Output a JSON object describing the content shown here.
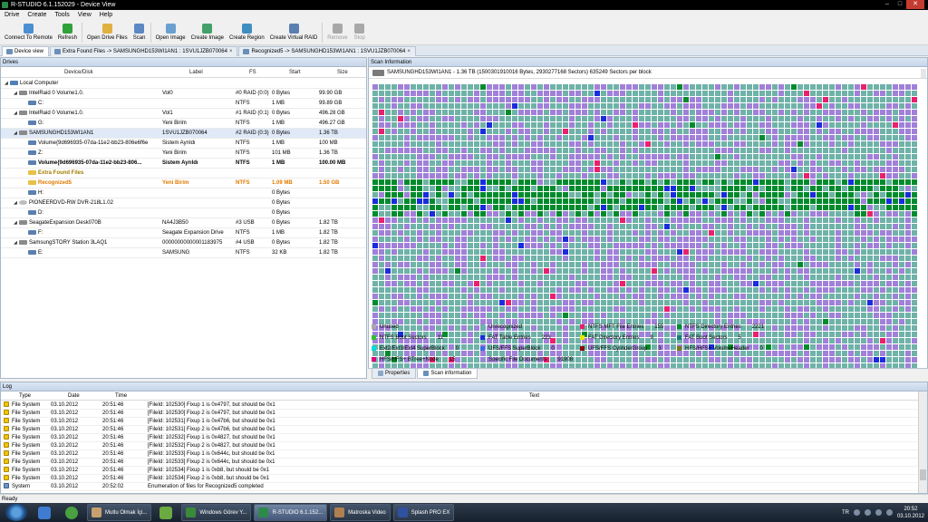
{
  "window": {
    "title": "R-STUDIO 6.1.152029 - Device View"
  },
  "menu": [
    "Drive",
    "Create",
    "Tools",
    "View",
    "Help"
  ],
  "toolbar": [
    {
      "label": "Connect To Remote",
      "icon": "connect-remote-icon",
      "color": "#4a8fd0",
      "enabled": true
    },
    {
      "label": "Refresh",
      "icon": "refresh-icon",
      "color": "#2fa23a",
      "enabled": true
    },
    {
      "label": "Open Drive Files",
      "icon": "open-drive-files-icon",
      "color": "#e0b040",
      "enabled": true
    },
    {
      "label": "Scan",
      "icon": "scan-icon",
      "color": "#5c88c4",
      "enabled": true
    },
    {
      "label": "Open Image",
      "icon": "open-image-icon",
      "color": "#6aa0d0",
      "enabled": true
    },
    {
      "label": "Create Image",
      "icon": "create-image-icon",
      "color": "#44a06a",
      "enabled": true
    },
    {
      "label": "Create Region",
      "icon": "create-region-icon",
      "color": "#3f8ec0",
      "enabled": true
    },
    {
      "label": "Create Virtual RAID",
      "icon": "create-virtual-raid-icon",
      "color": "#5a7fb0",
      "enabled": true
    },
    {
      "label": "Remove",
      "icon": "remove-icon",
      "color": "#a8a8a8",
      "enabled": false
    },
    {
      "label": "Stop",
      "icon": "stop-icon",
      "color": "#a8a8a8",
      "enabled": false
    }
  ],
  "tabs": [
    {
      "label": "Device view",
      "active": true,
      "closable": false
    },
    {
      "label": "Extra Found Files -> SAMSUNGHD153WI1AN1 : 1SVU1JZB070064",
      "active": false,
      "closable": true
    },
    {
      "label": "Recognized5 -> SAMSUNGHD153WI1AN1 : 1SVU1JZB070064",
      "active": false,
      "closable": true
    }
  ],
  "drives": {
    "title": "Drives",
    "columns": {
      "device": "Device/Disk",
      "label": "Label",
      "fs": "FS",
      "start": "Start",
      "size": "Size"
    },
    "rows": [
      {
        "indent": 0,
        "icon": "pc",
        "name": "Local Computer",
        "label": "",
        "fs": "",
        "start": "",
        "size": "",
        "style": ""
      },
      {
        "indent": 1,
        "icon": "hd",
        "name": "IntelRaid 0 Volume1.0.",
        "label": "Vol0",
        "fs": "#0 RAID (0:0)",
        "start": "0 Bytes",
        "size": "99.90 GB",
        "style": ""
      },
      {
        "indent": 2,
        "icon": "vol",
        "name": "C:",
        "label": "",
        "fs": "NTFS",
        "start": "1 MB",
        "size": "99.89 GB",
        "style": ""
      },
      {
        "indent": 1,
        "icon": "hd",
        "name": "IntelRaid 0 Volume1.0.",
        "label": "Vol1",
        "fs": "#1 RAID (0:1)",
        "start": "0 Bytes",
        "size": "496.28 GB",
        "style": ""
      },
      {
        "indent": 2,
        "icon": "vol",
        "name": "G:",
        "label": "Yeni Birim",
        "fs": "NTFS",
        "start": "1 MB",
        "size": "496.27 GB",
        "style": ""
      },
      {
        "indent": 1,
        "icon": "hd",
        "name": "SAMSUNGHD153WI1AN1",
        "label": "1SVU1JZB070064",
        "fs": "#2 RAID (0:3)",
        "start": "0 Bytes",
        "size": "1.36 TB",
        "style": "sel"
      },
      {
        "indent": 2,
        "icon": "vol",
        "name": "Volume{9d696935-07da-11e2-bb23-806e6f6e",
        "label": "Sistem Ayrıldı",
        "fs": "NTFS",
        "start": "1 MB",
        "size": "100 MB",
        "style": ""
      },
      {
        "indent": 2,
        "icon": "vol",
        "name": "Z:",
        "label": "Yeni Birim",
        "fs": "NTFS",
        "start": "101 MB",
        "size": "1.36 TB",
        "style": ""
      },
      {
        "indent": 2,
        "icon": "vol",
        "name": "Volume{9d696935-07da-11e2-bb23-806...",
        "label": "Sistem Ayrıldı",
        "fs": "NTFS",
        "start": "1 MB",
        "size": "100.00 MB",
        "style": "bold"
      },
      {
        "indent": 2,
        "icon": "fold",
        "name": "Extra Found Files",
        "label": "",
        "fs": "",
        "start": "",
        "size": "",
        "style": "olive"
      },
      {
        "indent": 2,
        "icon": "fold",
        "name": "Recognized5",
        "label": "Yeni Birim",
        "fs": "NTFS",
        "start": "1.09 MB",
        "size": "1.50 GB",
        "style": "orange"
      },
      {
        "indent": 2,
        "icon": "vol",
        "name": "H:",
        "label": "",
        "fs": "",
        "start": "0 Bytes",
        "size": "",
        "style": ""
      },
      {
        "indent": 1,
        "icon": "cd",
        "name": "PIONEERDVD-RW DVR-218L1.02",
        "label": "",
        "fs": "",
        "start": "0 Bytes",
        "size": "",
        "style": ""
      },
      {
        "indent": 2,
        "icon": "vol",
        "name": "D:",
        "label": "",
        "fs": "",
        "start": "0 Bytes",
        "size": "",
        "style": ""
      },
      {
        "indent": 1,
        "icon": "hd",
        "name": "SeagateExpansion Desk070B",
        "label": "NA4J3B50",
        "fs": "#3 USB",
        "start": "0 Bytes",
        "size": "1.82 TB",
        "style": ""
      },
      {
        "indent": 2,
        "icon": "vol",
        "name": "F:",
        "label": "Seagate Expansion Drive",
        "fs": "NTFS",
        "start": "1 MB",
        "size": "1.82 TB",
        "style": ""
      },
      {
        "indent": 1,
        "icon": "hd",
        "name": "SamsungSTORY Station 3LAQ1",
        "label": "00000000000001183975",
        "fs": "#4 USB",
        "start": "0 Bytes",
        "size": "1.82 TB",
        "style": ""
      },
      {
        "indent": 2,
        "icon": "vol",
        "name": "E:",
        "label": "SAMSUNG",
        "fs": "NTFS",
        "start": "32 KB",
        "size": "1.82 TB",
        "style": ""
      }
    ]
  },
  "scan": {
    "title": "Scan Information",
    "disk_info": "SAMSUNGHD153WI1AN1 - 1.36 TB (1500301910016 Bytes, 2930277168 Sectors) 635249 Sectors per block",
    "colors": {
      "unused": "#aaaaaa",
      "unrecognized": "#6fb2a8",
      "ntfs_mft": "#e8206e",
      "ntfs_dir": "#008b2d",
      "ntfs_boot": "#30c030",
      "fat_table": "#1a2cdc",
      "fat_dir": "#e8e800",
      "fat_boot": "#1a7a7a",
      "ext": "#00dddd",
      "ufs_super": "#3a6ae0",
      "ufs_cyl": "#8b0a0a",
      "hfs_vh": "#7a7a10",
      "hfs_btree": "#e00080",
      "specific": "#a080d8"
    },
    "legend": [
      {
        "label": "Unused",
        "color": "#aaaaaa",
        "count": ""
      },
      {
        "label": "Unrecognized",
        "color": "#6fb2a8",
        "count": ""
      },
      {
        "label": "NTFS MFT File Entries",
        "color": "#e8206e",
        "count": "155"
      },
      {
        "label": "NTFS Directory Entries",
        "color": "#008b2d",
        "count": "2221"
      },
      {
        "label": "NTFS Boot Sectors",
        "color": "#30c030",
        "count": "11"
      },
      {
        "label": "FAT Table Entries",
        "color": "#1a2cdc",
        "count": "223"
      },
      {
        "label": "FAT Directory Entries",
        "color": "#e8e800",
        "count": "9"
      },
      {
        "label": "FAT Boot Sectors",
        "color": "#1a7a7a",
        "count": "5"
      },
      {
        "label": "Ext2/Ext3/Ext4 SuperBlock",
        "color": "#00dddd",
        "count": "0"
      },
      {
        "label": "UFS/FFS SuperBlock",
        "color": "#3a6ae0",
        "count": "0"
      },
      {
        "label": "UFS/FFS CylinderGroup",
        "color": "#8b0a0a",
        "count": "3"
      },
      {
        "label": "HFS/HFS+ VolumeHeader",
        "color": "#7a7a10",
        "count": "0"
      },
      {
        "label": "HFS/HFS+ BTree+Node",
        "color": "#e00080",
        "count": "15"
      },
      {
        "label": "Specific File Documents",
        "color": "#a080d8",
        "count": "91908"
      }
    ],
    "tabs": [
      {
        "label": "Properties",
        "active": false
      },
      {
        "label": "Scan information",
        "active": true
      }
    ]
  },
  "log": {
    "title": "Log",
    "columns": {
      "type": "Type",
      "date": "Date",
      "time": "Time",
      "text": "Text"
    },
    "rows": [
      {
        "type": "File System",
        "date": "03.10.2012",
        "time": "20:51:46",
        "text": "[FileId: 102530] Fixup 1 is 0x4797, but should be 0x1",
        "kind": "warn"
      },
      {
        "type": "File System",
        "date": "03.10.2012",
        "time": "20:51:46",
        "text": "[FileId: 102530] Fixup 2 is 0x4797, but should be 0x1",
        "kind": "warn"
      },
      {
        "type": "File System",
        "date": "03.10.2012",
        "time": "20:51:46",
        "text": "[FileId: 102531] Fixup 1 is 0x47b6, but should be 0x1",
        "kind": "warn"
      },
      {
        "type": "File System",
        "date": "03.10.2012",
        "time": "20:51:46",
        "text": "[FileId: 102531] Fixup 2 is 0x47b6, but should be 0x1",
        "kind": "warn"
      },
      {
        "type": "File System",
        "date": "03.10.2012",
        "time": "20:51:46",
        "text": "[FileId: 102532] Fixup 1 is 0x4827, but should be 0x1",
        "kind": "warn"
      },
      {
        "type": "File System",
        "date": "03.10.2012",
        "time": "20:51:46",
        "text": "[FileId: 102532] Fixup 2 is 0x4827, but should be 0x1",
        "kind": "warn"
      },
      {
        "type": "File System",
        "date": "03.10.2012",
        "time": "20:51:46",
        "text": "[FileId: 102533] Fixup 1 is 0x644c, but should be 0x1",
        "kind": "warn"
      },
      {
        "type": "File System",
        "date": "03.10.2012",
        "time": "20:51:46",
        "text": "[FileId: 102533] Fixup 2 is 0x644c, but should be 0x1",
        "kind": "warn"
      },
      {
        "type": "File System",
        "date": "03.10.2012",
        "time": "20:51:46",
        "text": "[FileId: 102534] Fixup 1 is 0xb8, but should be 0x1",
        "kind": "warn"
      },
      {
        "type": "File System",
        "date": "03.10.2012",
        "time": "20:51:46",
        "text": "[FileId: 102534] Fixup 2 is 0xb8, but should be 0x1",
        "kind": "warn"
      },
      {
        "type": "System",
        "date": "03.10.2012",
        "time": "20:52:02",
        "text": "Enumeration of files for Recognized5 completed",
        "kind": "info"
      }
    ]
  },
  "status": "Ready",
  "taskbar": {
    "items": [
      {
        "label": "Mutlu Olmak İçi...",
        "color": "#c8a070",
        "active": false
      },
      {
        "label": "",
        "color": "#6aaa40",
        "active": false
      },
      {
        "label": "Windows Görev Y...",
        "color": "#3a8a3a",
        "active": false
      },
      {
        "label": "R-STUDIO 6.1.152...",
        "color": "#2c8a4a",
        "active": true
      },
      {
        "label": "Matroska Video",
        "color": "#b08050",
        "active": false
      },
      {
        "label": "Splash PRO EX",
        "color": "#3050a0",
        "active": false
      }
    ],
    "lang": "TR",
    "time": "20:52",
    "date": "03.10.2012"
  }
}
